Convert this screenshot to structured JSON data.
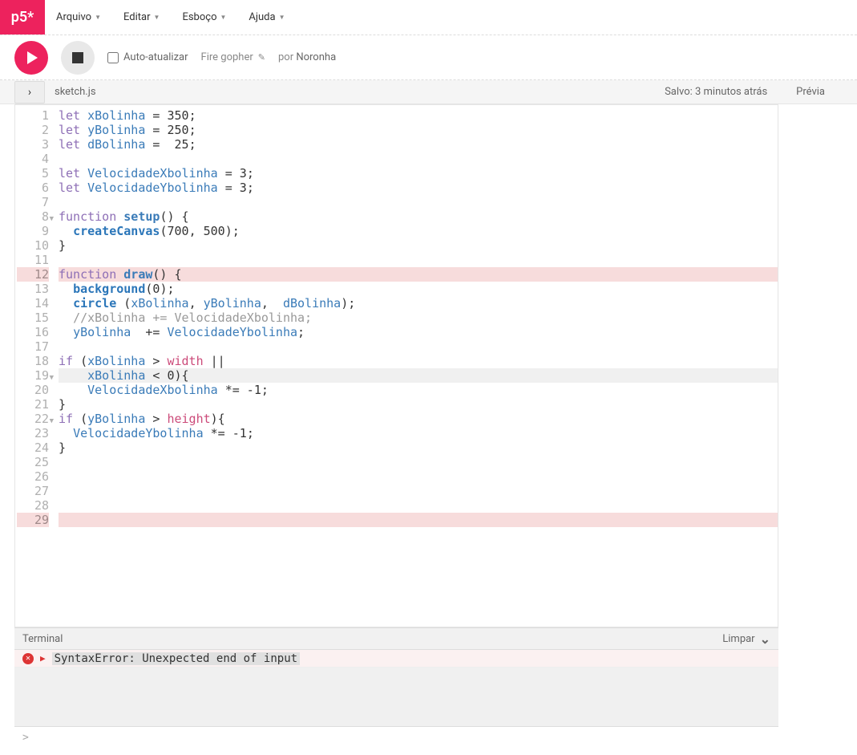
{
  "logo": "p5*",
  "menu": {
    "file": "Arquivo",
    "edit": "Editar",
    "sketch": "Esboço",
    "help": "Ajuda"
  },
  "toolbar": {
    "auto_refresh": "Auto-atualizar",
    "sketch_name": "Fire gopher",
    "by": "por",
    "author": "Noronha"
  },
  "file_header": {
    "filename": "sketch.js",
    "saved": "Salvo: 3 minutos atrás",
    "preview": "Prévia"
  },
  "code": {
    "lines": [
      {
        "n": "1",
        "fold": "",
        "hl": "",
        "tokens": [
          [
            "kw",
            "let "
          ],
          [
            "var",
            "xBolinha"
          ],
          [
            "",
            " = "
          ],
          [
            "num",
            "350"
          ],
          [
            "",
            ";"
          ]
        ]
      },
      {
        "n": "2",
        "fold": "",
        "hl": "",
        "tokens": [
          [
            "kw",
            "let "
          ],
          [
            "var",
            "yBolinha"
          ],
          [
            "",
            " = "
          ],
          [
            "num",
            "250"
          ],
          [
            "",
            ";"
          ]
        ]
      },
      {
        "n": "3",
        "fold": "",
        "hl": "",
        "tokens": [
          [
            "kw",
            "let "
          ],
          [
            "var",
            "dBolinha"
          ],
          [
            "",
            " =  "
          ],
          [
            "num",
            "25"
          ],
          [
            "",
            ";"
          ]
        ]
      },
      {
        "n": "4",
        "fold": "",
        "hl": "",
        "tokens": []
      },
      {
        "n": "5",
        "fold": "",
        "hl": "",
        "tokens": [
          [
            "kw",
            "let "
          ],
          [
            "var",
            "VelocidadeXbolinha"
          ],
          [
            "",
            " = "
          ],
          [
            "num",
            "3"
          ],
          [
            "",
            ";"
          ]
        ]
      },
      {
        "n": "6",
        "fold": "",
        "hl": "",
        "tokens": [
          [
            "kw",
            "let "
          ],
          [
            "var",
            "VelocidadeYbolinha"
          ],
          [
            "",
            " = "
          ],
          [
            "num",
            "3"
          ],
          [
            "",
            ";"
          ]
        ]
      },
      {
        "n": "7",
        "fold": "",
        "hl": "",
        "tokens": []
      },
      {
        "n": "8",
        "fold": "▼",
        "hl": "",
        "tokens": [
          [
            "kw",
            "function "
          ],
          [
            "fn",
            "setup"
          ],
          [
            "",
            "() {"
          ]
        ]
      },
      {
        "n": "9",
        "fold": "",
        "hl": "",
        "tokens": [
          [
            "",
            "  "
          ],
          [
            "bfn",
            "createCanvas"
          ],
          [
            "",
            "("
          ],
          [
            "num",
            "700"
          ],
          [
            "",
            ", "
          ],
          [
            "num",
            "500"
          ],
          [
            "",
            ");"
          ]
        ]
      },
      {
        "n": "10",
        "fold": "",
        "hl": "",
        "tokens": [
          [
            "",
            "}"
          ]
        ]
      },
      {
        "n": "11",
        "fold": "",
        "hl": "",
        "tokens": []
      },
      {
        "n": "12",
        "fold": "",
        "hl": "err",
        "tokens": [
          [
            "kw",
            "function "
          ],
          [
            "fn",
            "draw"
          ],
          [
            "",
            "() {"
          ]
        ]
      },
      {
        "n": "13",
        "fold": "",
        "hl": "",
        "tokens": [
          [
            "",
            "  "
          ],
          [
            "bfn",
            "background"
          ],
          [
            "",
            "("
          ],
          [
            "num",
            "0"
          ],
          [
            "",
            ");"
          ]
        ]
      },
      {
        "n": "14",
        "fold": "",
        "hl": "",
        "tokens": [
          [
            "",
            "  "
          ],
          [
            "bfn",
            "circle"
          ],
          [
            "",
            " ("
          ],
          [
            "var",
            "xBolinha"
          ],
          [
            "",
            ", "
          ],
          [
            "var",
            "yBolinha"
          ],
          [
            "",
            ",  "
          ],
          [
            "var",
            "dBolinha"
          ],
          [
            "",
            ");"
          ]
        ]
      },
      {
        "n": "15",
        "fold": "",
        "hl": "",
        "tokens": [
          [
            "",
            "  "
          ],
          [
            "cmt",
            "//xBolinha += VelocidadeXbolinha;"
          ]
        ]
      },
      {
        "n": "16",
        "fold": "",
        "hl": "",
        "tokens": [
          [
            "",
            "  "
          ],
          [
            "var",
            "yBolinha"
          ],
          [
            "",
            "  += "
          ],
          [
            "var",
            "VelocidadeYbolinha"
          ],
          [
            "",
            ";"
          ]
        ]
      },
      {
        "n": "17",
        "fold": "",
        "hl": "",
        "tokens": []
      },
      {
        "n": "18",
        "fold": "",
        "hl": "",
        "tokens": [
          [
            "kw",
            "if"
          ],
          [
            "",
            " ("
          ],
          [
            "var",
            "xBolinha"
          ],
          [
            "",
            " > "
          ],
          [
            "bi",
            "width"
          ],
          [
            "",
            " ||"
          ]
        ]
      },
      {
        "n": "19",
        "fold": "▼",
        "hl": "act",
        "tokens": [
          [
            "",
            "    "
          ],
          [
            "var",
            "xBolinha"
          ],
          [
            "",
            " < "
          ],
          [
            "num",
            "0"
          ],
          [
            "",
            "){"
          ]
        ]
      },
      {
        "n": "20",
        "fold": "",
        "hl": "",
        "tokens": [
          [
            "",
            "    "
          ],
          [
            "var",
            "VelocidadeXbolinha"
          ],
          [
            "",
            " *= -"
          ],
          [
            "num",
            "1"
          ],
          [
            "",
            ";"
          ]
        ]
      },
      {
        "n": "21",
        "fold": "",
        "hl": "",
        "tokens": [
          [
            "",
            "}"
          ]
        ]
      },
      {
        "n": "22",
        "fold": "▼",
        "hl": "",
        "tokens": [
          [
            "kw",
            "if"
          ],
          [
            "",
            " ("
          ],
          [
            "var",
            "yBolinha"
          ],
          [
            "",
            " > "
          ],
          [
            "bi",
            "height"
          ],
          [
            "",
            "){"
          ]
        ]
      },
      {
        "n": "23",
        "fold": "",
        "hl": "",
        "tokens": [
          [
            "",
            "  "
          ],
          [
            "var",
            "VelocidadeYbolinha"
          ],
          [
            "",
            " *= -"
          ],
          [
            "num",
            "1"
          ],
          [
            "",
            ";"
          ]
        ]
      },
      {
        "n": "24",
        "fold": "",
        "hl": "",
        "tokens": [
          [
            "",
            "}"
          ]
        ]
      },
      {
        "n": "25",
        "fold": "",
        "hl": "",
        "tokens": []
      },
      {
        "n": "26",
        "fold": "",
        "hl": "",
        "tokens": []
      },
      {
        "n": "27",
        "fold": "",
        "hl": "",
        "tokens": []
      },
      {
        "n": "28",
        "fold": "",
        "hl": "",
        "tokens": []
      },
      {
        "n": "29",
        "fold": "",
        "hl": "err",
        "tokens": []
      }
    ]
  },
  "terminal": {
    "title": "Terminal",
    "clear": "Limpar",
    "error_msg": "SyntaxError: Unexpected end of input",
    "prompt": ">"
  }
}
